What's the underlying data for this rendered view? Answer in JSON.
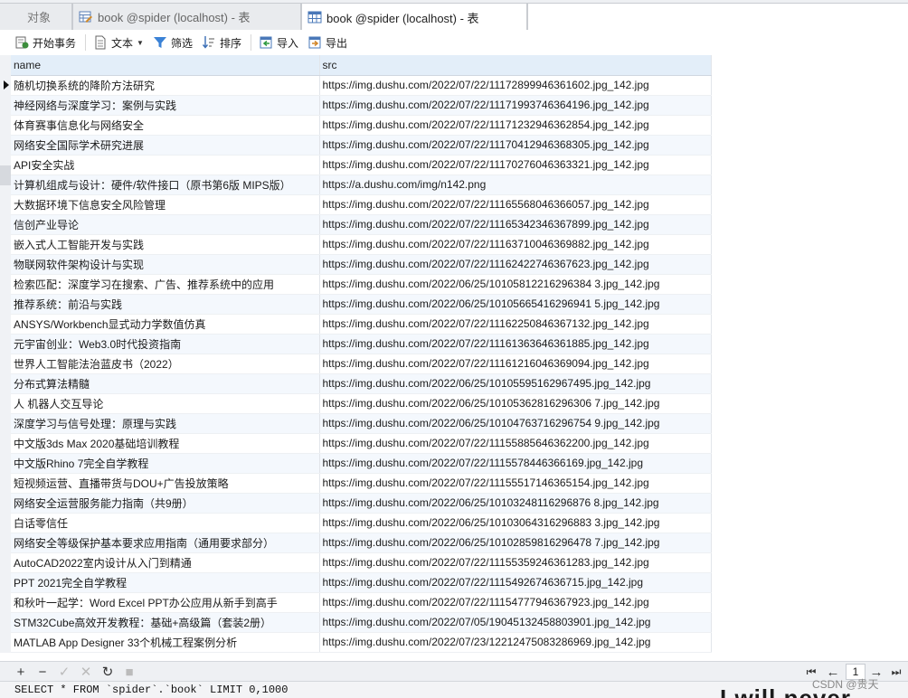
{
  "tabs": {
    "objects": "对象",
    "tab1": "book @spider (localhost) - 表",
    "tab2": "book @spider (localhost) - 表"
  },
  "toolbar": {
    "begin_transaction": "开始事务",
    "text": "文本",
    "filter": "筛选",
    "sort": "排序",
    "import": "导入",
    "export": "导出"
  },
  "columns": {
    "name": "name",
    "src": "src"
  },
  "rows": [
    {
      "name": "随机切换系统的降阶方法研究",
      "src": "https://img.dushu.com/2022/07/22/11172899946361602.jpg_142.jpg"
    },
    {
      "name": "神经网络与深度学习：案例与实践",
      "src": "https://img.dushu.com/2022/07/22/11171993746364196.jpg_142.jpg"
    },
    {
      "name": "体育赛事信息化与网络安全",
      "src": "https://img.dushu.com/2022/07/22/11171232946362854.jpg_142.jpg"
    },
    {
      "name": "网络安全国际学术研究进展",
      "src": "https://img.dushu.com/2022/07/22/11170412946368305.jpg_142.jpg"
    },
    {
      "name": "API安全实战",
      "src": "https://img.dushu.com/2022/07/22/11170276046363321.jpg_142.jpg"
    },
    {
      "name": "计算机组成与设计：硬件/软件接口（原书第6版 MIPS版）",
      "src": "https://a.dushu.com/img/n142.png"
    },
    {
      "name": "大数据环境下信息安全风险管理",
      "src": "https://img.dushu.com/2022/07/22/11165568046366057.jpg_142.jpg"
    },
    {
      "name": "信创产业导论",
      "src": "https://img.dushu.com/2022/07/22/11165342346367899.jpg_142.jpg"
    },
    {
      "name": "嵌入式人工智能开发与实践",
      "src": "https://img.dushu.com/2022/07/22/11163710046369882.jpg_142.jpg"
    },
    {
      "name": "物联网软件架构设计与实现",
      "src": "https://img.dushu.com/2022/07/22/11162422746367623.jpg_142.jpg"
    },
    {
      "name": "检索匹配：深度学习在搜索、广告、推荐系统中的应用",
      "src": "https://img.dushu.com/2022/06/25/10105812216296384 3.jpg_142.jpg"
    },
    {
      "name": "推荐系统：前沿与实践",
      "src": "https://img.dushu.com/2022/06/25/10105665416296941 5.jpg_142.jpg"
    },
    {
      "name": "ANSYS/Workbench显式动力学数值仿真",
      "src": "https://img.dushu.com/2022/07/22/11162250846367132.jpg_142.jpg"
    },
    {
      "name": "元宇宙创业：Web3.0时代投资指南",
      "src": "https://img.dushu.com/2022/07/22/11161363646361885.jpg_142.jpg"
    },
    {
      "name": "世界人工智能法治蓝皮书（2022）",
      "src": "https://img.dushu.com/2022/07/22/11161216046369094.jpg_142.jpg"
    },
    {
      "name": "分布式算法精髓",
      "src": "https://img.dushu.com/2022/06/25/10105595162967495.jpg_142.jpg"
    },
    {
      "name": "人 机器人交互导论",
      "src": "https://img.dushu.com/2022/06/25/10105362816296306 7.jpg_142.jpg"
    },
    {
      "name": "深度学习与信号处理：原理与实践",
      "src": "https://img.dushu.com/2022/06/25/10104763716296754 9.jpg_142.jpg"
    },
    {
      "name": "中文版3ds Max 2020基础培训教程",
      "src": "https://img.dushu.com/2022/07/22/11155885646362200.jpg_142.jpg"
    },
    {
      "name": "中文版Rhino 7完全自学教程",
      "src": "https://img.dushu.com/2022/07/22/1115578446366169.jpg_142.jpg"
    },
    {
      "name": "短视频运营、直播带货与DOU+广告投放策略",
      "src": "https://img.dushu.com/2022/07/22/11155517146365154.jpg_142.jpg"
    },
    {
      "name": "网络安全运营服务能力指南（共9册）",
      "src": "https://img.dushu.com/2022/06/25/10103248116296876 8.jpg_142.jpg"
    },
    {
      "name": "白话零信任",
      "src": "https://img.dushu.com/2022/06/25/10103064316296883 3.jpg_142.jpg"
    },
    {
      "name": "网络安全等级保护基本要求应用指南（通用要求部分）",
      "src": "https://img.dushu.com/2022/06/25/10102859816296478 7.jpg_142.jpg"
    },
    {
      "name": "AutoCAD2022室内设计从入门到精通",
      "src": "https://img.dushu.com/2022/07/22/11155359246361283.jpg_142.jpg"
    },
    {
      "name": "PPT 2021完全自学教程",
      "src": "https://img.dushu.com/2022/07/22/1115492674636715.jpg_142.jpg"
    },
    {
      "name": "和秋叶一起学：Word Excel PPT办公应用从新手到高手",
      "src": "https://img.dushu.com/2022/07/22/11154777946367923.jpg_142.jpg"
    },
    {
      "name": "STM32Cube高效开发教程：基础+高级篇（套装2册）",
      "src": "https://img.dushu.com/2022/07/05/19045132458803901.jpg_142.jpg"
    },
    {
      "name": "MATLAB App Designer 33个机械工程案例分析",
      "src": "https://img.dushu.com/2022/07/23/12212475083286969.jpg_142.jpg"
    }
  ],
  "navigation": {
    "page": "1"
  },
  "status": {
    "sql": "SELECT * FROM `spider`.`book` LIMIT 0,1000"
  },
  "watermark": "CSDN @贵天",
  "overlay_text": "I will never"
}
